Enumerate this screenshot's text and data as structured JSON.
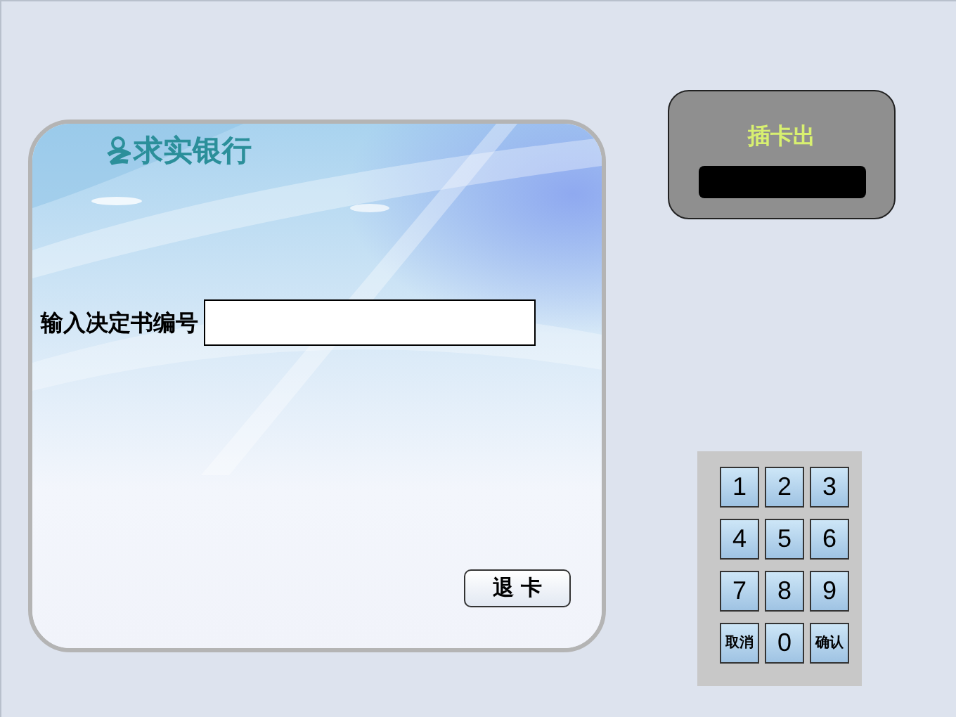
{
  "bank": {
    "name": "求实银行"
  },
  "form": {
    "label": "输入决定书编号",
    "exit_button": "退 卡"
  },
  "card_slot": {
    "label": "插卡出"
  },
  "keypad": {
    "keys": [
      {
        "label": "1",
        "kind": "digit"
      },
      {
        "label": "2",
        "kind": "digit"
      },
      {
        "label": "3",
        "kind": "digit"
      },
      {
        "label": "4",
        "kind": "digit"
      },
      {
        "label": "5",
        "kind": "digit"
      },
      {
        "label": "6",
        "kind": "digit"
      },
      {
        "label": "7",
        "kind": "digit"
      },
      {
        "label": "8",
        "kind": "digit"
      },
      {
        "label": "9",
        "kind": "digit"
      },
      {
        "label": "取消",
        "kind": "action"
      },
      {
        "label": "0",
        "kind": "digit"
      },
      {
        "label": "确认",
        "kind": "action"
      }
    ]
  }
}
